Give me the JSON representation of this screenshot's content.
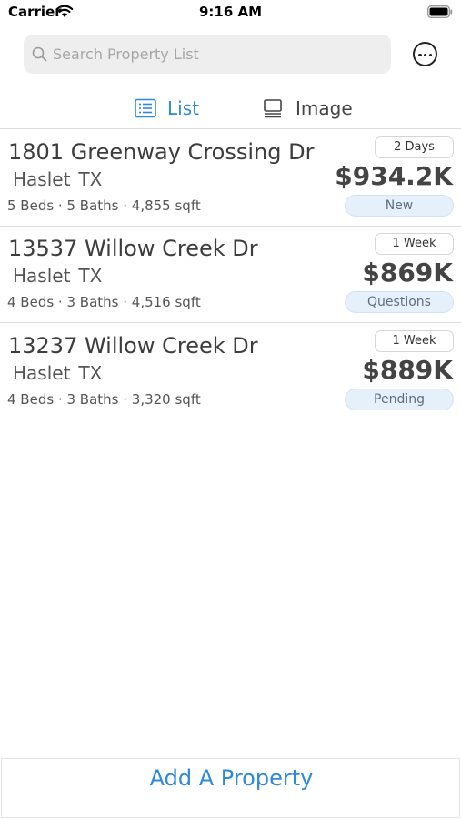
{
  "status_bar": {
    "carrier": "Carrier",
    "time": "9:16 AM",
    "wifi_icon": "wifi-icon",
    "battery_icon": "battery-icon"
  },
  "search": {
    "placeholder": "Search Property List",
    "icon": "search-icon"
  },
  "more_button": {
    "icon": "more-horizontal-circle-icon"
  },
  "tabs": [
    {
      "label": "List",
      "icon": "list-icon",
      "selected": true
    },
    {
      "label": "Image",
      "icon": "image-icon",
      "selected": false
    }
  ],
  "properties": [
    {
      "address": "1801 Greenway Crossing Dr",
      "city": "Haslet",
      "state": "TX",
      "specs": "5 Beds · 5 Baths · 4,855 sqft",
      "age": "2 Days",
      "price": "$934.2K",
      "status": "New"
    },
    {
      "address": "13537 Willow Creek Dr",
      "city": "Haslet",
      "state": "TX",
      "specs": "4 Beds · 3 Baths · 4,516 sqft",
      "age": "1 Week",
      "price": "$869K",
      "status": "Questions"
    },
    {
      "address": "13237 Willow Creek Dr",
      "city": "Haslet",
      "state": "TX",
      "specs": "4 Beds · 3 Baths · 3,320 sqft",
      "age": "1 Week",
      "price": "$889K",
      "status": "Pending"
    }
  ],
  "add_button": {
    "label": "Add A Property"
  },
  "colors": {
    "accent": "#2d89db",
    "badge_background": "#e6f0fb",
    "search_background": "#eeeeee"
  }
}
